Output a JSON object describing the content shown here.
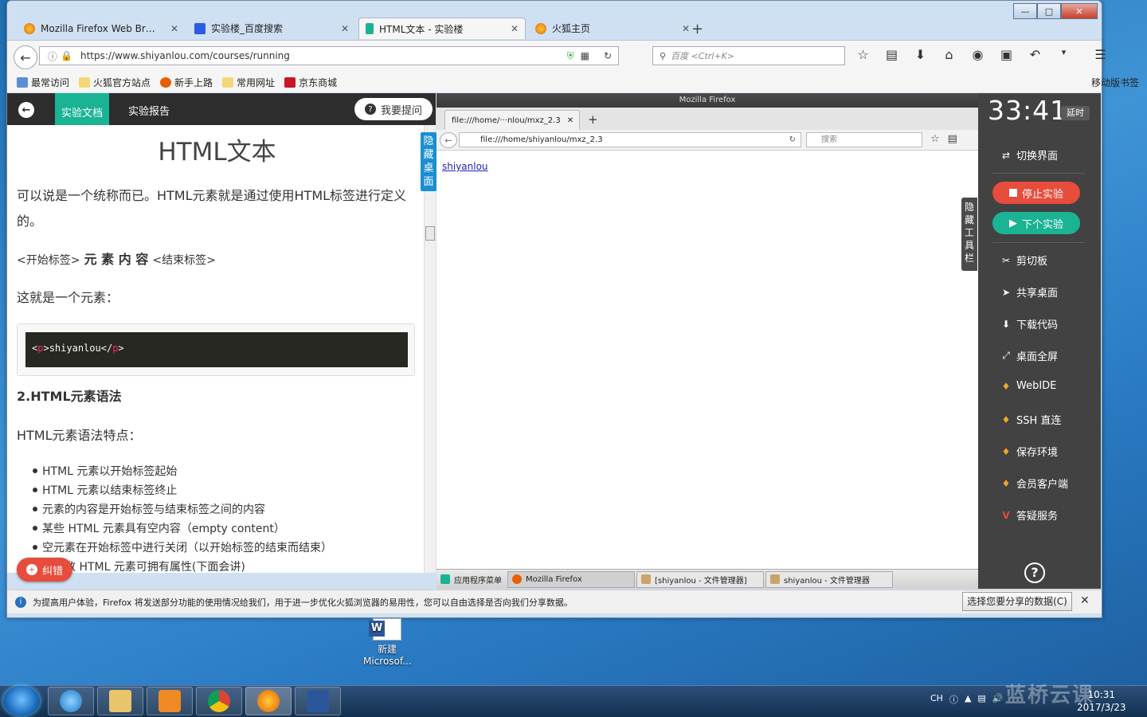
{
  "browser": {
    "tabs": [
      {
        "label": "Mozilla Firefox Web Bro...",
        "icon": "firefox-icon"
      },
      {
        "label": "实验楼_百度搜索",
        "icon": "baidu-icon"
      },
      {
        "label": "HTML文本 - 实验楼",
        "icon": "shiyanlou-icon"
      },
      {
        "label": "火狐主页",
        "icon": "firefox-icon"
      }
    ],
    "url": "https://www.shiyanlou.com/courses/running",
    "search_placeholder": "百度 <Ctrl+K>",
    "bookmarks": [
      "最常访问",
      "火狐官方站点",
      "新手上路",
      "常用网址",
      "京东商城"
    ],
    "mobile_bookmarks": "移动版书签"
  },
  "lab": {
    "tab_doc": "实验文档",
    "tab_report": "实验报告",
    "ask_button": "我要提问",
    "hide_desktop": "隐藏桌面",
    "error_button": "纠错",
    "doc": {
      "title": "HTML文本",
      "para1": "可以说是一个统称而已。HTML元素就是通过使用HTML标签进行定义的。",
      "syntax_prefix": "<开始标签>",
      "syntax_mid": "元 素 内 容",
      "syntax_suffix": "<结束标签>",
      "para2": "这就是一个元素：",
      "code": {
        "open_lt": "<",
        "open_tag": "p",
        "open_gt": ">",
        "text": "shiyanlou",
        "close_lt": "</",
        "close_tag": "p",
        "close_gt": ">"
      },
      "section_heading": "2.HTML元素语法",
      "section_intro": "HTML元素语法特点：",
      "bullets": [
        "HTML 元素以开始标签起始",
        "HTML 元素以结束标签终止",
        "元素的内容是开始标签与结束标签之间的内容",
        "某些 HTML 元素具有空内容（empty content）",
        "空元素在开始标签中进行关闭（以开始标签的结束而结束）",
        "大多数 HTML 元素可拥有属性(下面会讲)"
      ]
    }
  },
  "vm": {
    "window_title": "Mozilla Firefox",
    "tab_label": "file:///home/···nlou/mxz_2.3",
    "url": "file:///home/shiyanlou/mxz_2.3",
    "search_placeholder": "搜索",
    "link_text": "shiyanlou",
    "hide_toolbar": "隐藏工具栏",
    "taskbar": [
      "应用程序菜单",
      "Mozilla Firefox",
      "[shiyanlou - 文件管理器]",
      "shiyanlou - 文件管理器"
    ]
  },
  "panel": {
    "timer": "33:41",
    "delay": "延时",
    "switch_ui": "切换界面",
    "stop": "停止实验",
    "next": "下个实验",
    "items": [
      "剪切板",
      "共享桌面",
      "下载代码",
      "桌面全屏",
      "WebIDE",
      "SSH 直连",
      "保存环境",
      "会员客户端",
      "答疑服务"
    ]
  },
  "notification": {
    "text": "为提高用户体验，Firefox 将发送部分功能的使用情况给我们，用于进一步优化火狐浏览器的易用性，您可以自由选择是否向我们分享数据。",
    "button": "选择您要分享的数据(C)"
  },
  "desktop": {
    "icon_label_1": "新建",
    "icon_label_2": "Microsof..."
  },
  "taskbar": {
    "lang": "CH",
    "time": "10:31",
    "date": "2017/3/23",
    "watermark": "蓝桥云课"
  },
  "colors": {
    "accent": "#1ab394",
    "stop": "#e74c3c",
    "link": "#2020c0"
  }
}
